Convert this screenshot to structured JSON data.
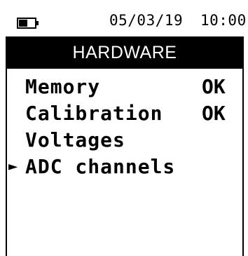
{
  "status_bar": {
    "date": "05/03/19",
    "time": "10:00",
    "battery_icon": "battery-low-icon"
  },
  "title": "HARDWARE",
  "menu": {
    "items": [
      {
        "marker": "",
        "label": "Memory",
        "status": "OK"
      },
      {
        "marker": "",
        "label": "Calibration",
        "status": "OK"
      },
      {
        "marker": "",
        "label": "Voltages",
        "status": ""
      },
      {
        "marker": "►",
        "label": "ADC channels",
        "status": ""
      }
    ]
  }
}
